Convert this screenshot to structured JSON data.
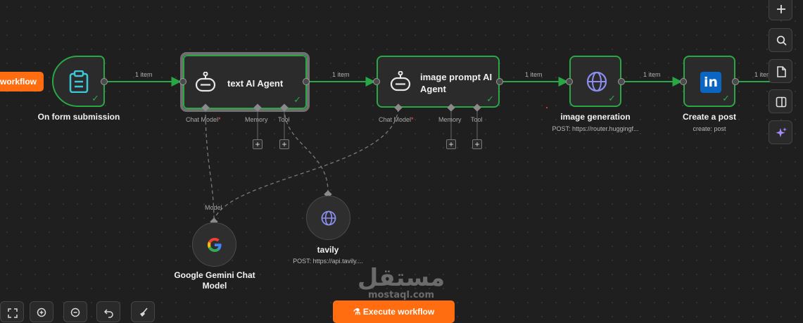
{
  "canvas": {
    "edge_label": "1 item"
  },
  "left_button": {
    "label": "workflow"
  },
  "nodes": {
    "form_trigger": {
      "label": "On form submission",
      "icon": "clipboard-icon"
    },
    "text_agent": {
      "title": "text AI Agent",
      "icon": "robot-icon",
      "ports": {
        "chat_model": "Chat Model",
        "required_mark": "*",
        "memory": "Memory",
        "tool": "Tool"
      }
    },
    "image_prompt_agent": {
      "title": "image prompt AI Agent",
      "icon": "robot-icon",
      "ports": {
        "chat_model": "Chat Model",
        "required_mark": "*",
        "memory": "Memory",
        "tool": "Tool"
      }
    },
    "image_generation": {
      "label": "image generation",
      "subtitle": "POST: https://router.huggingf...",
      "icon": "globe-icon"
    },
    "linkedin": {
      "label": "Create a post",
      "subtitle": "create: post",
      "icon": "linkedin-icon",
      "logo_text": "in"
    },
    "gemini": {
      "label": "Google Gemini Chat Model",
      "port_label": "Model",
      "icon": "google-icon"
    },
    "tavily": {
      "label": "tavily",
      "subtitle": "POST: https://api.tavily....",
      "icon": "globe-icon"
    }
  },
  "right_toolbar": [
    {
      "name": "add-node-button",
      "icon": "plus-icon"
    },
    {
      "name": "search-nodes-button",
      "icon": "search-icon"
    },
    {
      "name": "sticky-note-button",
      "icon": "note-icon"
    },
    {
      "name": "toggle-panel-button",
      "icon": "panel-icon"
    },
    {
      "name": "ai-assistant-button",
      "icon": "sparkle-icon"
    }
  ],
  "bottom_toolbar": [
    {
      "name": "fit-view-button",
      "icon": "fit-icon"
    },
    {
      "name": "zoom-in-button",
      "icon": "zoom-in-icon"
    },
    {
      "name": "zoom-out-button",
      "icon": "zoom-out-icon"
    },
    {
      "name": "undo-button",
      "icon": "undo-icon"
    },
    {
      "name": "tidy-up-button",
      "icon": "broom-icon"
    }
  ],
  "execute_button": {
    "label": "Execute workflow",
    "icon": "flask-icon"
  },
  "watermark": {
    "text": "مستقل",
    "subtext": "mostaql.com"
  },
  "colors": {
    "success": "#2aa745",
    "accent": "#ff6d10",
    "linkedin": "#0a66c2",
    "ai_purple": "#a78bfa"
  }
}
